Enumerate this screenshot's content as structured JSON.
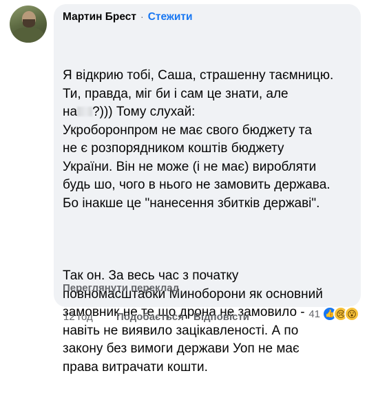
{
  "comment": {
    "author": "Мартин Брест",
    "separator": "·",
    "follow_label": "Стежити",
    "paragraph1_lines": [
      "Я відкрию тобі, Саша, страшенну таємницю.",
      "Ти, правда, міг би і сам це знати, але",
      "на",
      "?))) Тому слухай:",
      "Укроборонпром не має свого бюджету та",
      "не є розпорядником коштів бюджету",
      "України. Він не може (і не має) виробляти",
      "будь шо, чого в нього не замовить держава.",
      "Бо інакше це \"нанесення збитків державі\"."
    ],
    "paragraph2_lines": [
      "Так он. За весь час з початку",
      "повномасштабки Миноборони як основний",
      "замовник не те що дрона не замовило -",
      "навіть не виявило зацікавленості. А по",
      "закону без вимоги держави Уоп не має",
      "права витрачати кошти."
    ],
    "translate_label": "Переглянути переклад"
  },
  "actions": {
    "time": "12 год",
    "like_label": "Подобається",
    "reply_label": "Відповісти",
    "reaction_count": "41"
  },
  "icons": {
    "avatar": "avatar-photo",
    "reaction_like": "thumbs-up-icon",
    "reaction_sad": "sad-face-icon",
    "reaction_wow": "wow-face-icon"
  },
  "colors": {
    "bubble": "#f0f2f5",
    "link": "#1877f2",
    "secondary_text": "#65676b"
  }
}
